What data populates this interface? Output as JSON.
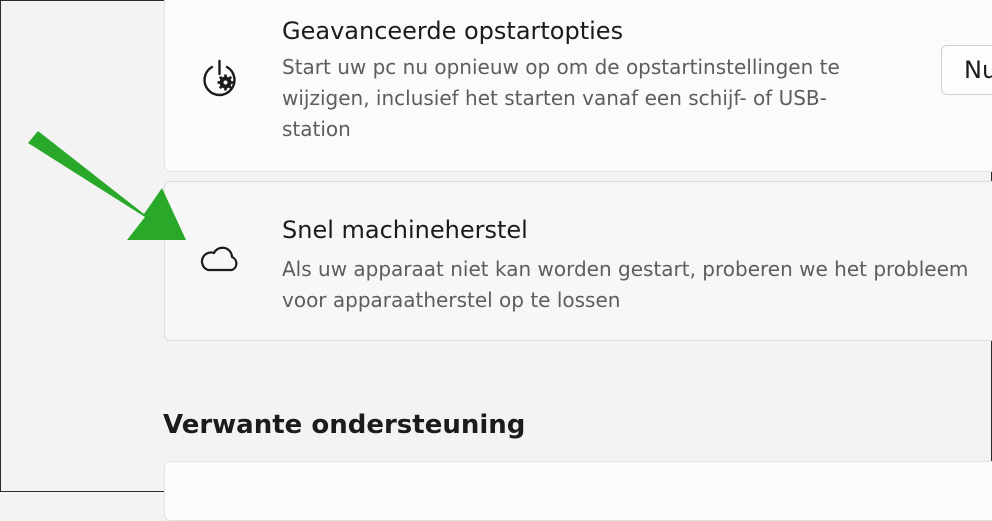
{
  "recovery_options": {
    "advanced_startup": {
      "title": "Geavanceerde opstartopties",
      "description_lines": [
        "Start uw pc nu opnieuw op om de opstartinstellingen te",
        "wijzigen, inclusief het starten vanaf een schijf- of USB-",
        "station"
      ],
      "button_label": "Nu opnieuw opstarten",
      "button_visible_text": "Nu",
      "icon": "power-gear-icon"
    },
    "quick_machine_recovery": {
      "title": "Snel machineherstel",
      "description_lines": [
        "Als uw apparaat niet kan worden gestart, proberen we het probleem",
        "voor apparaatherstel op te lossen"
      ],
      "icon": "cloud-icon"
    }
  },
  "related_support": {
    "heading": "Verwante ondersteuning"
  },
  "annotation": {
    "icon": "green-arrow-icon",
    "color": "#2aa82a"
  }
}
